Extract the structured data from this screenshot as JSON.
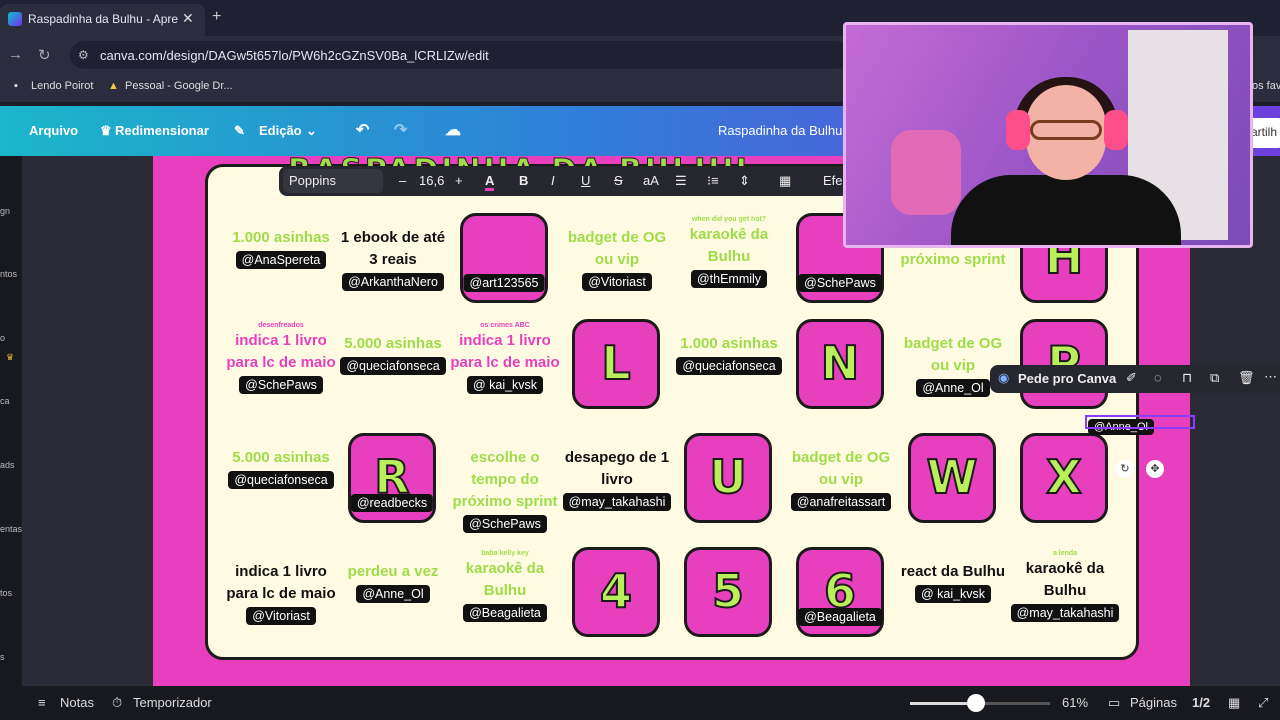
{
  "browser": {
    "tab_title": "Raspadinha da Bulhu - Apresen",
    "tab_close": "✕",
    "new_tab": "+",
    "url": "canva.com/design/DAGw5t657lo/PW6h2cGZnSV0Ba_lCRLIZw/edit",
    "bookmarks": [
      "Lendo Poirot",
      "Pessoal - Google Dr..."
    ],
    "bookmarks_overflow": "os fav"
  },
  "editor": {
    "menu": {
      "file": "Arquivo",
      "resize": "Redimensionar",
      "edit": "Edição"
    },
    "doc_title": "Raspadinha da Bulhu",
    "share_partial": "artilh",
    "left_rail": [
      "gn",
      "ntos",
      "o",
      "ca",
      "ads",
      "entas",
      "tos",
      "s"
    ],
    "text_toolbar": {
      "font": "Poppins",
      "minus": "–",
      "size": "16,6",
      "plus": "+",
      "effects": "Efe"
    },
    "ai_bar": {
      "label": "Pede pro Canva"
    },
    "bottom": {
      "notes": "Notas",
      "timer": "Temporizador",
      "zoom": "61%",
      "pages_label": "Páginas",
      "pages": "1/2",
      "zoom_level": 0.47
    }
  },
  "board": {
    "headline": "RASPADINHA DA BULHU",
    "cells": [
      {
        "main": "1.000 asinhas",
        "tag": "@AnaSpereta",
        "color": "g"
      },
      {
        "main": "1 ebook de até 3 reais",
        "tag": "@ArkanthaNero",
        "color": "k"
      },
      {
        "tile": "",
        "tag": "@art123565"
      },
      {
        "main": "badget de OG ou vip",
        "tag": "@Vitoriast",
        "color": "g"
      },
      {
        "sub": "when did you get hot?",
        "main": "karaokê da Bulhu",
        "tag": "@thEmmily",
        "color": "g"
      },
      {
        "tile": "",
        "tag": "@SchePaws"
      },
      {
        "main": "tempo do próximo sprint",
        "color": "g"
      },
      {
        "tile": "H"
      },
      {
        "sub": "desenfreados",
        "main": "indica 1 livro para lc de maio",
        "tag": "@SchePaws",
        "color": "p"
      },
      {
        "main": "5.000 asinhas",
        "tag": "@queciafonseca",
        "color": "g"
      },
      {
        "sub": "os crimes ABC",
        "main": "indica 1 livro para lc de maio",
        "tag": "@ kai_kvsk",
        "color": "p"
      },
      {
        "tile": "L"
      },
      {
        "main": "1.000 asinhas",
        "tag": "@queciafonseca",
        "color": "g"
      },
      {
        "tile": "N"
      },
      {
        "main": "badget de OG ou vip",
        "tag": "@Anne_Ol",
        "color": "g"
      },
      {
        "tile": "P"
      },
      {
        "main": "5.000 asinhas",
        "tag": "@queciafonseca",
        "color": "g"
      },
      {
        "tile": "R",
        "tag": "@readbecks"
      },
      {
        "main": "escolhe o tempo do próximo sprint",
        "tag": "@SchePaws",
        "color": "g"
      },
      {
        "main": "desapego de 1 livro",
        "tag": "@may_takahashi",
        "color": "k"
      },
      {
        "tile": "U"
      },
      {
        "main": "badget de OG ou vip",
        "tag": "@anafreitassart",
        "color": "g"
      },
      {
        "tile": "W"
      },
      {
        "tile": "X"
      },
      {
        "main": "indica 1 livro para lc de maio",
        "tag": "@Vitoriast",
        "color": "k"
      },
      {
        "main": "perdeu a vez",
        "tag": "@Anne_Ol",
        "color": "g"
      },
      {
        "sub": "baba kelly key",
        "main": "karaokê da Bulhu",
        "tag": "@Beagalieta",
        "color": "g"
      },
      {
        "tile": "4"
      },
      {
        "tile": "5"
      },
      {
        "tile": "6",
        "tag": "@Beagalieta"
      },
      {
        "main": "react da Bulhu",
        "tag": "@ kai_kvsk",
        "color": "k"
      },
      {
        "sub": "a lenda",
        "main": "karaokê da Bulhu",
        "tag": "@may_takahashi",
        "color": "k"
      }
    ],
    "selected_tag": "@Anne_Ol"
  },
  "colors": {
    "canvas_pink": "#e83fbe",
    "lime": "#9fdc4a",
    "board_bg": "#fffbe3"
  }
}
